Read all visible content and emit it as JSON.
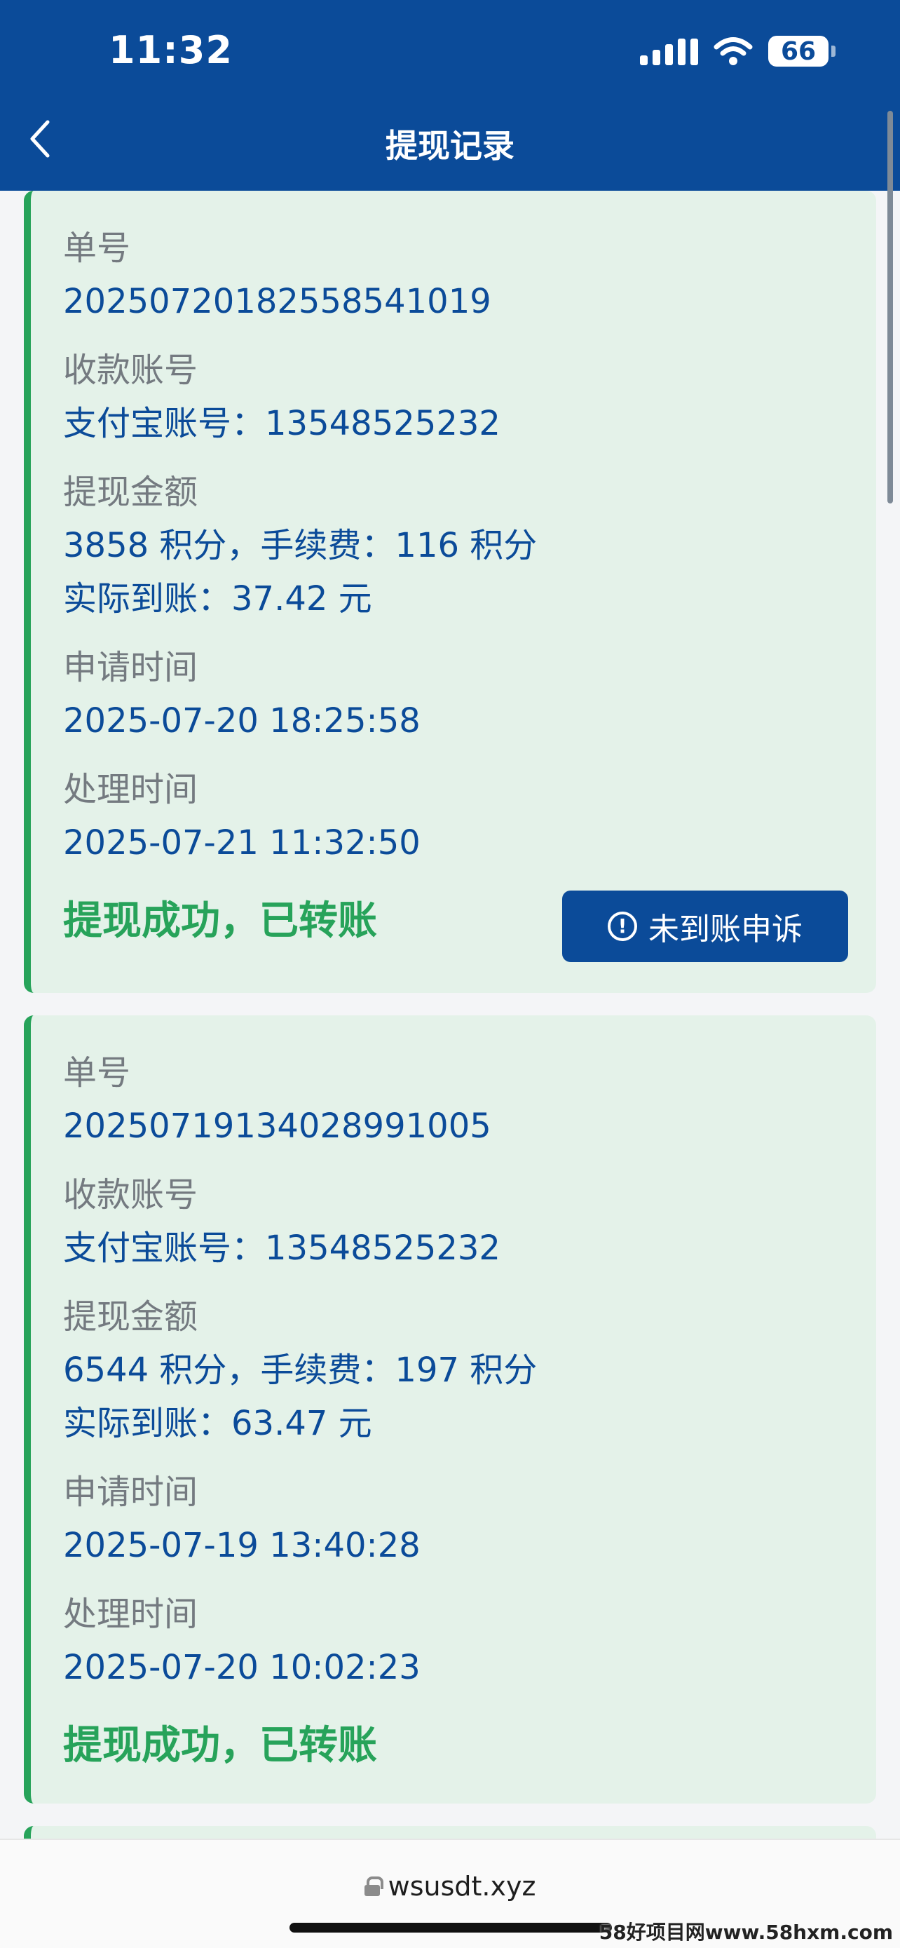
{
  "status_bar": {
    "time": "11:32",
    "battery": "66"
  },
  "nav": {
    "title": "提现记录"
  },
  "labels": {
    "order_no": "单号",
    "account": "收款账号",
    "amount": "提现金额",
    "apply_time": "申请时间",
    "process_time": "处理时间"
  },
  "records": [
    {
      "order_no": "2025072018255854101​9",
      "account": "支付宝账号：13548525232",
      "amount_line": "3858 积分，手续费：116 积分",
      "received_line": "实际到账：37.42 元",
      "apply_time": "2025-07-20 18:25:58",
      "process_time": "2025-07-21 11:32:50",
      "status": "提现成功，已转账",
      "appeal_label": "未到账申诉"
    },
    {
      "order_no": "20250719134028991005",
      "account": "支付宝账号：13548525232",
      "amount_line": "6544 积分，手续费：197 积分",
      "received_line": "实际到账：63.47 元",
      "apply_time": "2025-07-19 13:40:28",
      "process_time": "2025-07-20 10:02:23",
      "status": "提现成功，已转账"
    }
  ],
  "browser": {
    "url": "wsusdt.xyz"
  },
  "watermark": "58好项目网www.58hxm.com",
  "colors": {
    "primary": "#0b4b99",
    "success": "#27a35a",
    "card_bg": "#e4f2e9"
  },
  "icons": [
    "back-chevron-icon",
    "signal-icon",
    "wifi-icon",
    "battery-icon",
    "alert-circle-icon",
    "lock-icon"
  ]
}
